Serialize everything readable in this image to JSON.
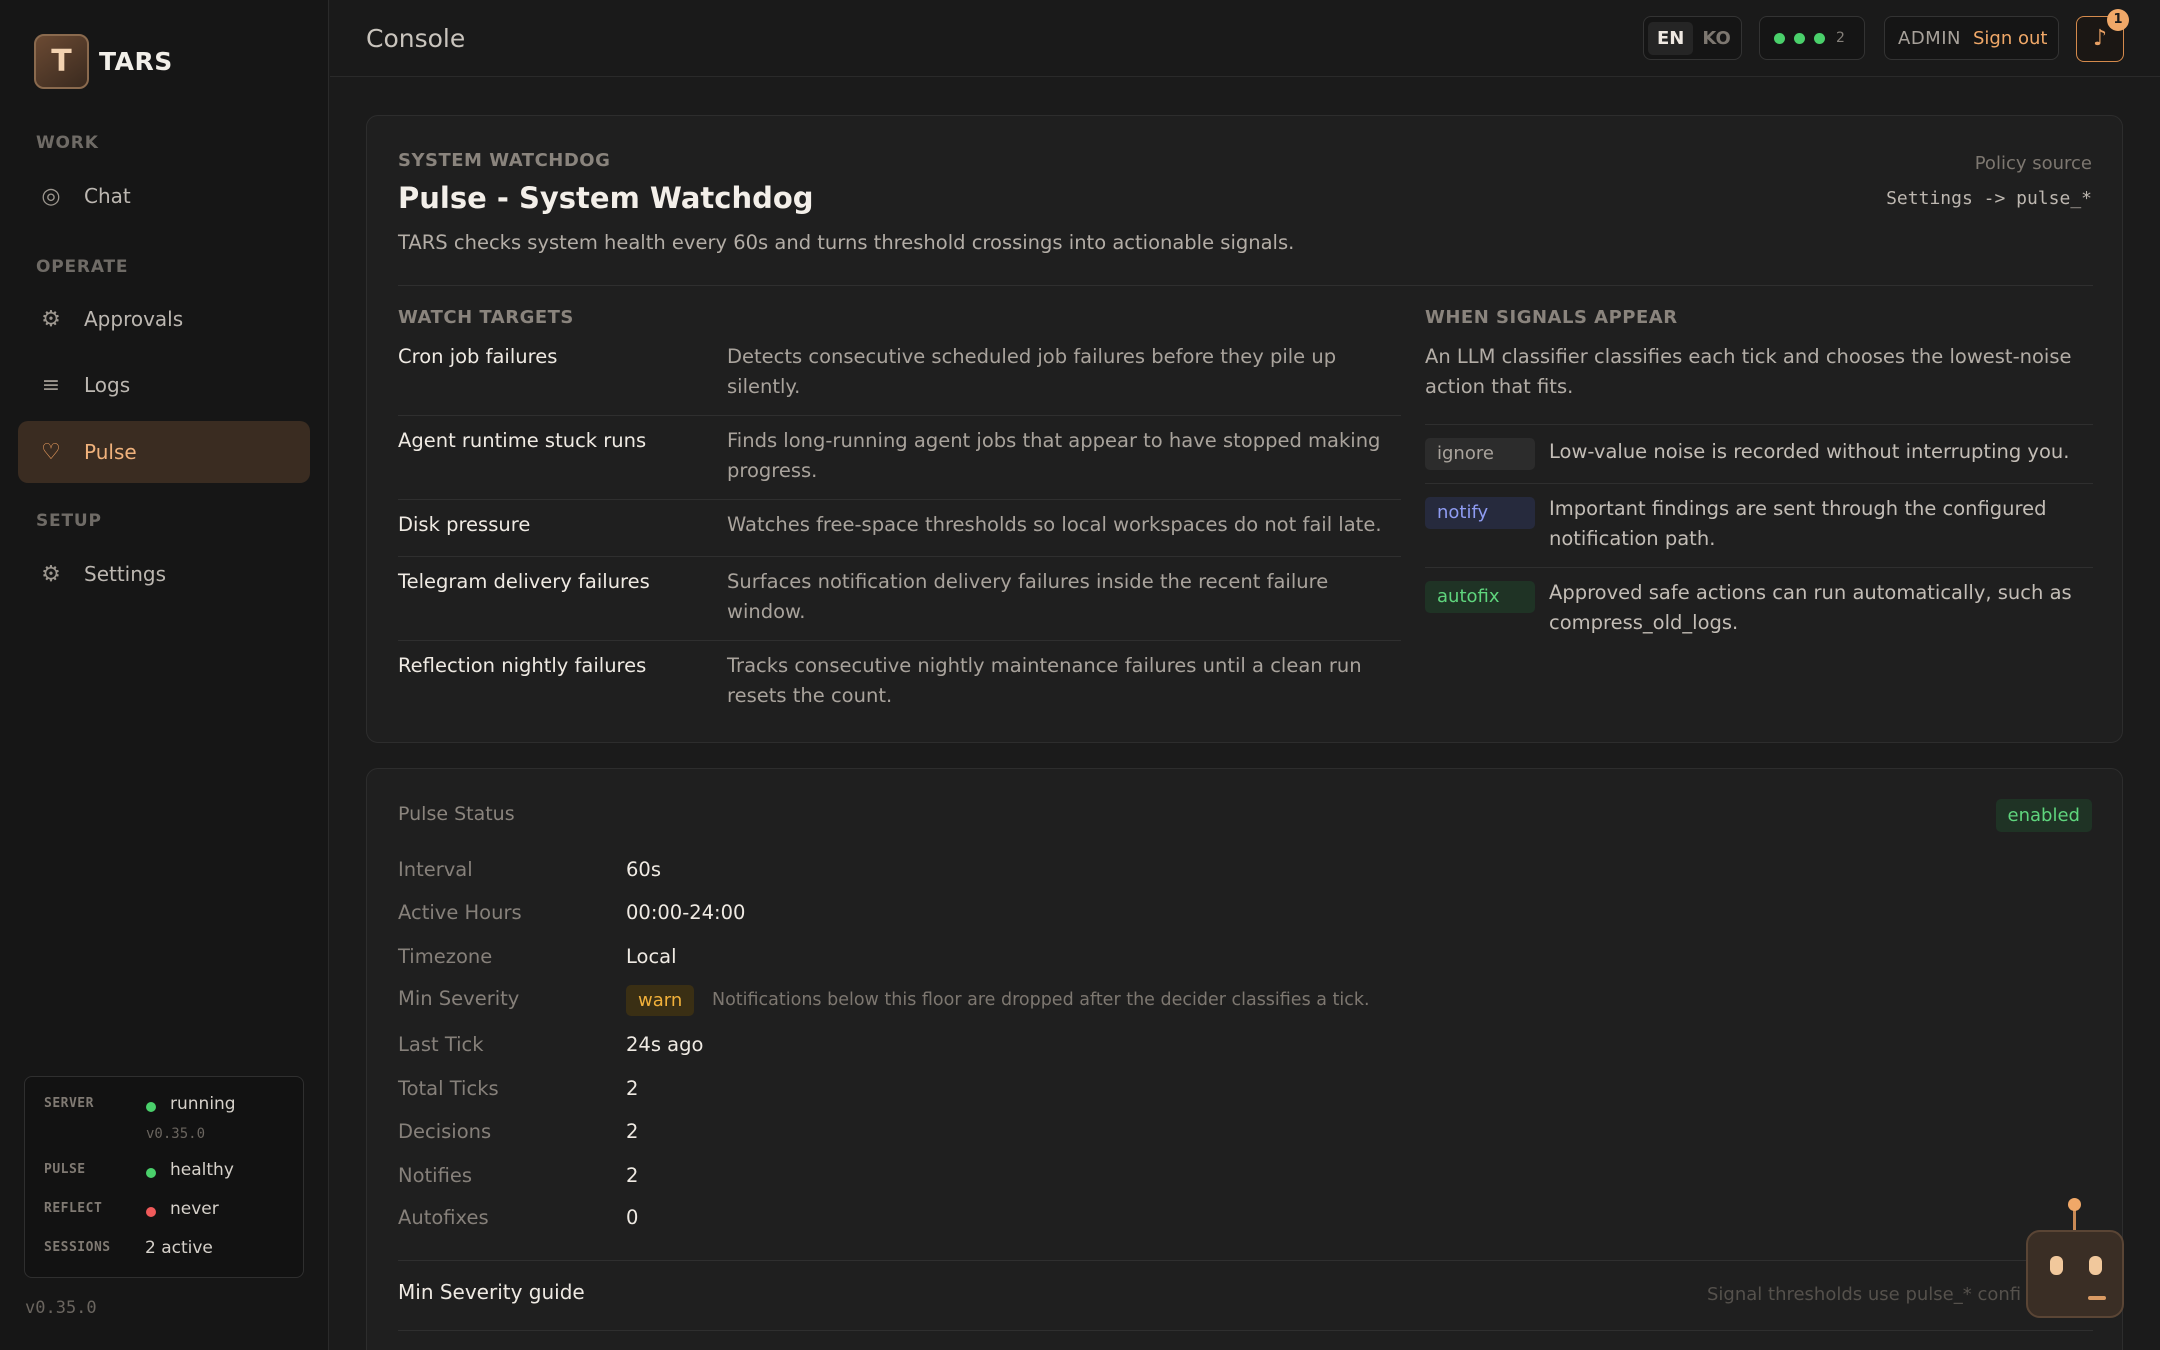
{
  "sidebar": {
    "brand": "TARS",
    "logo_glyph": "T",
    "sections": {
      "work": "WORK",
      "operate": "OPERATE",
      "setup": "SETUP"
    },
    "items": [
      {
        "label": "Chat",
        "icon": "target-icon",
        "glyph": "◎"
      },
      {
        "label": "Approvals",
        "icon": "gear-icon",
        "glyph": "⚙"
      },
      {
        "label": "Logs",
        "icon": "list-icon",
        "glyph": "≡"
      },
      {
        "label": "Pulse",
        "icon": "heart-icon",
        "glyph": "♡",
        "active": true
      },
      {
        "label": "Settings",
        "icon": "cog-icon",
        "glyph": "⚙"
      }
    ],
    "status": {
      "server_key": "SERVER",
      "server_val": "running",
      "server_version": "v0.35.0",
      "pulse_key": "PULSE",
      "pulse_val": "healthy",
      "reflect_key": "REFLECT",
      "reflect_val": "never",
      "sessions_key": "SESSIONS",
      "sessions_val": "2 active",
      "colors": {
        "ok": "#4ad06b",
        "bad": "#f05a5a"
      }
    },
    "version": "v0.35.0"
  },
  "topbar": {
    "title": "Console",
    "lang_en": "EN",
    "lang_ko": "KO",
    "dots_count": "2",
    "role": "ADMIN",
    "signout": "Sign out",
    "bell_glyph": "♪",
    "bell_badge": "1"
  },
  "watchdog": {
    "eyebrow": "SYSTEM WATCHDOG",
    "title": "Pulse - System Watchdog",
    "lead": "TARS checks system health every 60s and turns threshold crossings into actionable signals.",
    "policy_label": "Policy source",
    "policy_value": "Settings -> pulse_*",
    "targets_heading": "WATCH TARGETS",
    "targets": [
      {
        "name": "Cron job failures",
        "desc": "Detects consecutive scheduled job failures before they pile up silently."
      },
      {
        "name": "Agent runtime stuck runs",
        "desc": "Finds long-running agent jobs that appear to have stopped making progress."
      },
      {
        "name": "Disk pressure",
        "desc": "Watches free-space thresholds so local workspaces do not fail late."
      },
      {
        "name": "Telegram delivery failures",
        "desc": "Surfaces notification delivery failures inside the recent failure window."
      },
      {
        "name": "Reflection nightly failures",
        "desc": "Tracks consecutive nightly maintenance failures until a clean run resets the count."
      }
    ],
    "signals_heading": "WHEN SIGNALS APPEAR",
    "signals_lead": "An LLM classifier classifies each tick and chooses the lowest-noise action that fits.",
    "signals": [
      {
        "tag": "ignore",
        "desc": "Low-value noise is recorded without interrupting you."
      },
      {
        "tag": "notify",
        "desc": "Important findings are sent through the configured notification path."
      },
      {
        "tag": "autofix",
        "desc": "Approved safe actions can run automatically, such as compress_old_logs."
      }
    ]
  },
  "status": {
    "heading": "Pulse Status",
    "state_badge": "enabled",
    "rows": [
      {
        "key": "Interval",
        "value": "60s"
      },
      {
        "key": "Active Hours",
        "value": "00:00-24:00"
      },
      {
        "key": "Timezone",
        "value": "Local"
      },
      {
        "key": "Min Severity",
        "value": "warn"
      },
      {
        "key": "Last Tick",
        "value": "24s ago"
      },
      {
        "key": "Total Ticks",
        "value": "2"
      },
      {
        "key": "Decisions",
        "value": "2"
      },
      {
        "key": "Notifies",
        "value": "2"
      },
      {
        "key": "Autofixes",
        "value": "0"
      }
    ],
    "severity_note": "Notifications below this floor are dropped after the decider classifies a tick.",
    "guide_title": "Min Severity guide",
    "guide_note": "Signal thresholds use pulse_* confi"
  }
}
